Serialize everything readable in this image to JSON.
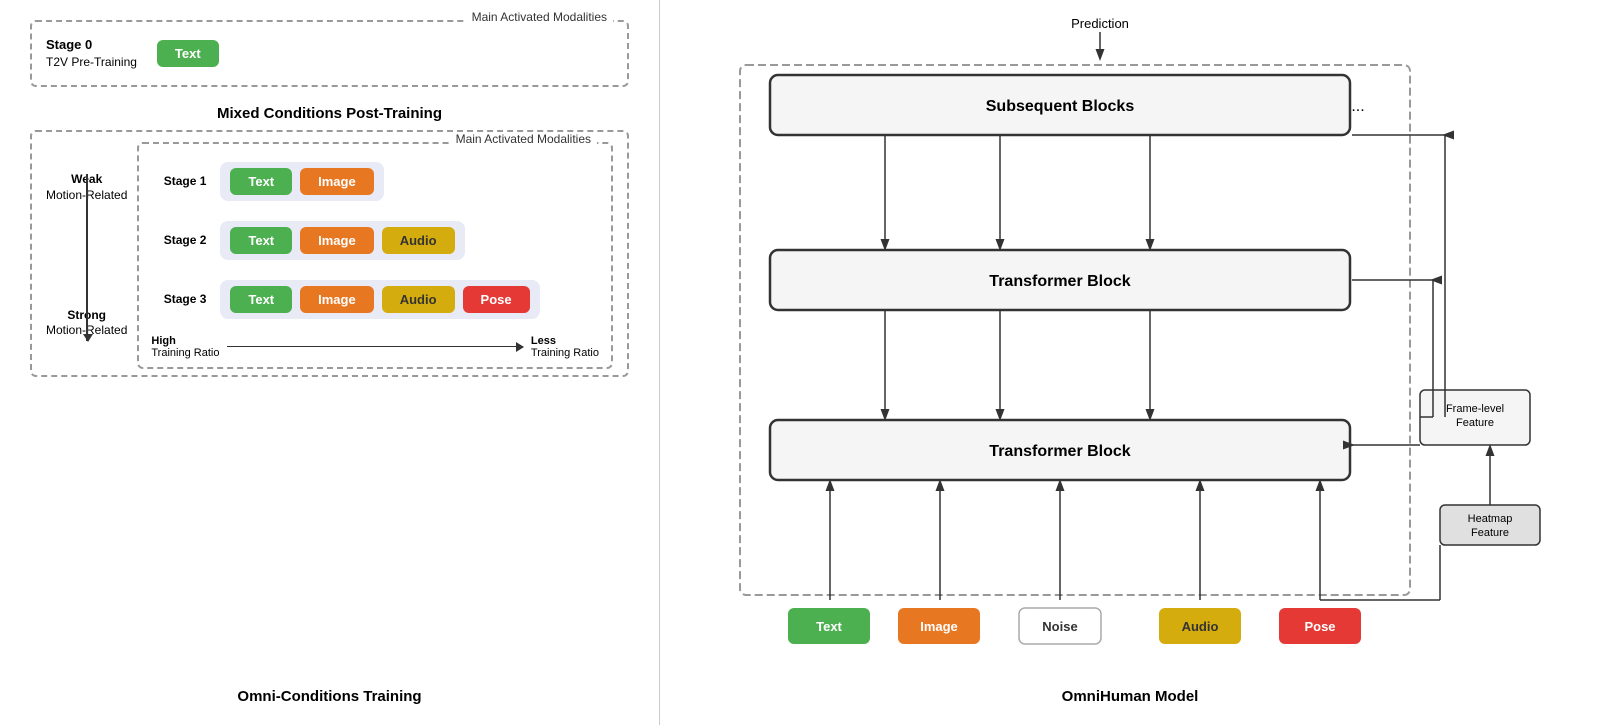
{
  "left": {
    "stage0": {
      "box_title": "Main Activated Modalities",
      "stage_label": "Stage 0",
      "stage_sub": "T2V Pre-Training",
      "chip": "Text"
    },
    "mixed_title": "Mixed Conditions Post-Training",
    "weak_label": "Weak\nMotion-Related",
    "strong_label": "Strong\nMotion-Related",
    "inner_box_title": "Main Activated Modalities",
    "high_ratio": "High\nTraining Ratio",
    "less_ratio": "Less\nTraining Ratio",
    "stages": [
      {
        "label": "Stage 1",
        "chips": [
          "Text",
          "Image"
        ]
      },
      {
        "label": "Stage 2",
        "chips": [
          "Text",
          "Image",
          "Audio"
        ]
      },
      {
        "label": "Stage 3",
        "chips": [
          "Text",
          "Image",
          "Audio",
          "Pose"
        ]
      }
    ],
    "caption": "Omni-Conditions Training"
  },
  "right": {
    "prediction_label": "Prediction",
    "subsequent_block": "Subsequent Blocks",
    "dots": "...",
    "transformer_block1": "Transformer Block",
    "transformer_block2": "Transformer Block",
    "frame_level_feature": "Frame-level\nFeature",
    "heatmap_feature": "Heatmap\nFeature",
    "inputs": [
      "Text",
      "Image",
      "Noise",
      "Audio",
      "Pose"
    ],
    "caption": "OmniHuman Model"
  }
}
